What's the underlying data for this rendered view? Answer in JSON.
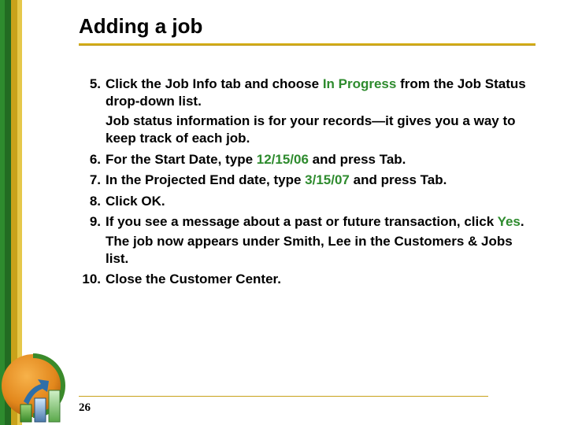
{
  "title": "Adding a job",
  "page_number": "26",
  "steps": [
    {
      "n": "5.",
      "runs": [
        {
          "t": "Click the Job Info tab and choose "
        },
        {
          "t": "In Progress",
          "cls": "green"
        },
        {
          "t": " from the Job Status drop-down list."
        }
      ],
      "sub": [
        {
          "t": "Job status information is for your records—it gives you a way to keep track of each job."
        }
      ]
    },
    {
      "n": "6.",
      "runs": [
        {
          "t": "For the Start Date, type "
        },
        {
          "t": "12/15/06",
          "cls": "green"
        },
        {
          "t": " and press Tab."
        }
      ]
    },
    {
      "n": "7.",
      "runs": [
        {
          "t": "In the Projected End date, type "
        },
        {
          "t": "3/15/07",
          "cls": "green"
        },
        {
          "t": " and press Tab."
        }
      ]
    },
    {
      "n": "8.",
      "runs": [
        {
          "t": "Click OK."
        }
      ]
    },
    {
      "n": "9.",
      "runs": [
        {
          "t": "If you see a message about a past or future transaction, click "
        },
        {
          "t": "Yes",
          "cls": "green"
        },
        {
          "t": "."
        }
      ],
      "sub": [
        {
          "t": "The job now appears under Smith, Lee in the Customers & Jobs list."
        }
      ]
    },
    {
      "n": "10.",
      "runs": [
        {
          "t": "Close the Customer Center."
        }
      ]
    }
  ]
}
